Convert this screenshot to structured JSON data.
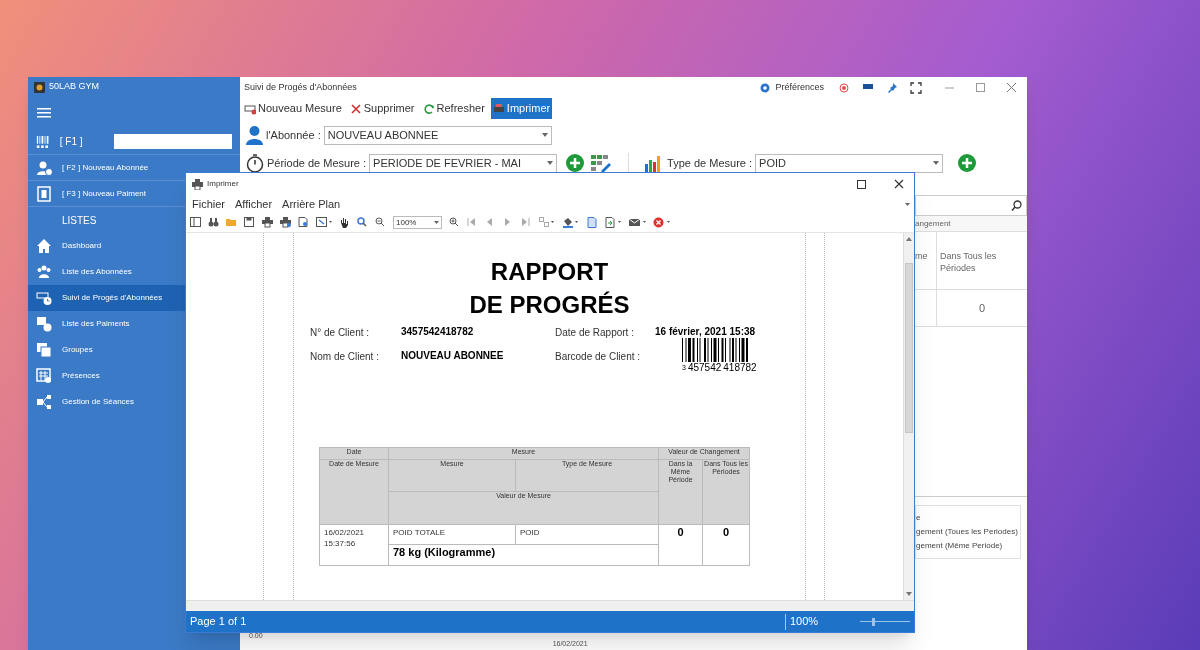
{
  "sidebar": {
    "app_title": "50LAB GYM",
    "f1_label": "[ F1 ]",
    "quick_actions": [
      {
        "label": "[ F2 ] Nouveau Abonnée"
      },
      {
        "label": "[ F3 ] Nouveau Paiment"
      }
    ],
    "section_title": "LISTES",
    "items": [
      {
        "label": "Dashboard",
        "selected": false
      },
      {
        "label": "Liste des Abonnées",
        "selected": false
      },
      {
        "label": "Suivi de Progés d'Abonnées",
        "selected": true
      },
      {
        "label": "Liste des Paiments",
        "selected": false
      },
      {
        "label": "Groupes",
        "selected": false
      },
      {
        "label": "Présences",
        "selected": false
      },
      {
        "label": "Gestion de Séances",
        "selected": false
      }
    ]
  },
  "main_window": {
    "title": "Suivi de Progés d'Abonnées",
    "preferences": "Préférences",
    "toolbar": [
      {
        "label": "Nouveau Mesure",
        "selected": false
      },
      {
        "label": "Supprimer",
        "selected": false
      },
      {
        "label": "Refresher",
        "selected": false
      },
      {
        "label": "Imprimer",
        "selected": true
      }
    ],
    "abonne": {
      "label": "l'Abonnée :",
      "value": "NOUVEAU ABONNEE"
    },
    "periode": {
      "label": "Période de Mesure :",
      "value": "PERIODE DE FEVRIER - MAI"
    },
    "type_mesure": {
      "label": "Type de Mesure :",
      "value": "POID"
    },
    "grid": {
      "group_header": "angement",
      "column_1": "me",
      "column_2": "Dans Tous les Périodes",
      "cell": "0"
    },
    "legend": [
      "e",
      "gement (Toues les Periodes)",
      "gement (Même Periode)"
    ],
    "chart_axis": {
      "y_label": "0.00",
      "x_label": "16/02/2021"
    }
  },
  "print_dialog": {
    "title": "Imprimer",
    "menu": [
      "Fichier",
      "Afficher",
      "Arrière Plan"
    ],
    "zoom": "100%",
    "report": {
      "title_lines": [
        "RAPPORT",
        "DE PROGRÉS"
      ],
      "fields": [
        {
          "label": "N° de Client :",
          "value": "3457542418782"
        },
        {
          "label": "Date de Rapport :",
          "value": "16 février, 2021 15:38"
        },
        {
          "label": "Nom de Client :",
          "value": "NOUVEAU ABONNEE"
        },
        {
          "label": "Barcode de Client :"
        }
      ],
      "barcode_digits": [
        "3",
        "457542",
        "418782"
      ],
      "table": {
        "group_headers": [
          "Date",
          "Mesure",
          "Valeur de Changement"
        ],
        "columns": [
          "Date de Mesure",
          "Mesure",
          "Type de Mesure",
          "Dans la Même Période",
          "Dans Tous les Périodes"
        ],
        "sub_header": "Valeur de Mesure",
        "row": {
          "date": "16/02/2021 15:37:56",
          "mesure": "POID TOTALE",
          "type": "POID",
          "valeur": "78 kg (Kilogramme)",
          "meme_periode": "0",
          "tous_periodes": "0"
        }
      }
    },
    "status": {
      "page": "Page 1 of 1",
      "zoom": "100%",
      "zoom_slider": {
        "level": 0.25
      }
    }
  }
}
